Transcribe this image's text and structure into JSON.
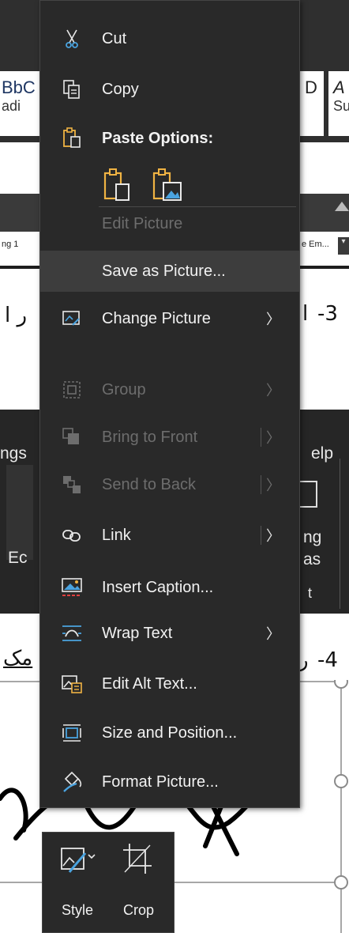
{
  "background": {
    "style_preview_1": "BbC",
    "style_name_1": "adi",
    "style_preview_2": "D",
    "style_preview_3": "A",
    "style_name_2": "Su",
    "style_chip_left": "ng 1",
    "style_chip_right": "e Em...",
    "step3_number": "-3",
    "step3_text_left": "ر ا",
    "step3_text_right": "ا",
    "ribbon_left_tab": "ngs",
    "ribbon_right_tab": "elp",
    "ribbon_left_cmd": "Ec",
    "ribbon_right_cmd1": "ng",
    "ribbon_right_cmd2": "as",
    "ribbon_right_cmd3": "t",
    "step4_number": "-4",
    "step4_text_left": "مک",
    "step4_text_right": "ر"
  },
  "menu": {
    "cut": "Cut",
    "copy": "Copy",
    "paste_options": "Paste Options:",
    "edit_picture": "Edit Picture",
    "save_as_picture": "Save as Picture...",
    "change_picture": "Change Picture",
    "group": "Group",
    "bring_to_front": "Bring to Front",
    "send_to_back": "Send to Back",
    "link": "Link",
    "insert_caption": "Insert Caption...",
    "wrap_text": "Wrap Text",
    "edit_alt_text": "Edit Alt Text...",
    "size_and_position": "Size and Position...",
    "format_picture": "Format Picture..."
  },
  "mini_toolbar": {
    "style": "Style",
    "crop": "Crop"
  },
  "colors": {
    "menu_bg": "#292929",
    "hover_bg": "#3d3d3d",
    "disabled_text": "#6d6d6d",
    "accent_icon": "#f0b343",
    "accent_blue": "#4aa3df"
  }
}
